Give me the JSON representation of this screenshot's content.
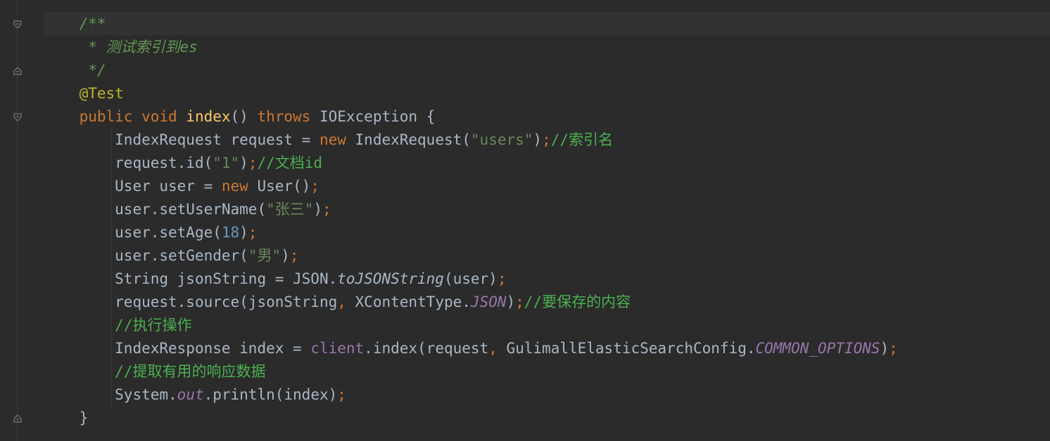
{
  "code_lines": [
    {
      "indent": "    ",
      "tokens": [
        {
          "t": "cmt",
          "v": "/**"
        }
      ]
    },
    {
      "indent": "     ",
      "tokens": [
        {
          "t": "cmt",
          "v": "* 测试索引到es"
        }
      ]
    },
    {
      "indent": "     ",
      "tokens": [
        {
          "t": "cmt",
          "v": "*/"
        }
      ]
    },
    {
      "indent": "    ",
      "tokens": [
        {
          "t": "ann",
          "v": "@Test"
        }
      ]
    },
    {
      "indent": "    ",
      "tokens": [
        {
          "t": "kw",
          "v": "public void "
        },
        {
          "t": "fn",
          "v": "index"
        },
        {
          "t": "plain",
          "v": "() "
        },
        {
          "t": "kw",
          "v": "throws "
        },
        {
          "t": "plain",
          "v": "IOException {"
        }
      ]
    },
    {
      "indent": "        ",
      "tokens": [
        {
          "t": "plain",
          "v": "IndexRequest request = "
        },
        {
          "t": "kw",
          "v": "new "
        },
        {
          "t": "plain",
          "v": "IndexRequest("
        },
        {
          "t": "str",
          "v": "\"users\""
        },
        {
          "t": "plain",
          "v": ")"
        },
        {
          "t": "kw",
          "v": ";"
        },
        {
          "t": "lcmt",
          "v": "//索引名"
        }
      ]
    },
    {
      "indent": "        ",
      "tokens": [
        {
          "t": "plain",
          "v": "request.id("
        },
        {
          "t": "str",
          "v": "\"1\""
        },
        {
          "t": "plain",
          "v": ")"
        },
        {
          "t": "kw",
          "v": ";"
        },
        {
          "t": "lcmt",
          "v": "//文档id"
        }
      ]
    },
    {
      "indent": "        ",
      "tokens": [
        {
          "t": "plain",
          "v": "User user = "
        },
        {
          "t": "kw",
          "v": "new "
        },
        {
          "t": "plain",
          "v": "User()"
        },
        {
          "t": "kw",
          "v": ";"
        }
      ]
    },
    {
      "indent": "        ",
      "tokens": [
        {
          "t": "plain",
          "v": "user.setUserName("
        },
        {
          "t": "str",
          "v": "\"张三\""
        },
        {
          "t": "plain",
          "v": ")"
        },
        {
          "t": "kw",
          "v": ";"
        }
      ]
    },
    {
      "indent": "        ",
      "tokens": [
        {
          "t": "plain",
          "v": "user.setAge("
        },
        {
          "t": "num",
          "v": "18"
        },
        {
          "t": "plain",
          "v": ")"
        },
        {
          "t": "kw",
          "v": ";"
        }
      ]
    },
    {
      "indent": "        ",
      "tokens": [
        {
          "t": "plain",
          "v": "user.setGender("
        },
        {
          "t": "str",
          "v": "\"男\""
        },
        {
          "t": "plain",
          "v": ")"
        },
        {
          "t": "kw",
          "v": ";"
        }
      ]
    },
    {
      "indent": "        ",
      "tokens": [
        {
          "t": "plain",
          "v": "String jsonString = JSON."
        },
        {
          "t": "ital",
          "v": "toJSONString"
        },
        {
          "t": "plain",
          "v": "(user)"
        },
        {
          "t": "kw",
          "v": ";"
        }
      ]
    },
    {
      "indent": "        ",
      "tokens": [
        {
          "t": "plain",
          "v": "request.source(jsonString"
        },
        {
          "t": "kw",
          "v": ", "
        },
        {
          "t": "plain",
          "v": "XContentType."
        },
        {
          "t": "fldi",
          "v": "JSON"
        },
        {
          "t": "plain",
          "v": ")"
        },
        {
          "t": "kw",
          "v": ";"
        },
        {
          "t": "lcmt",
          "v": "//要保存的内容"
        }
      ]
    },
    {
      "indent": "        ",
      "tokens": [
        {
          "t": "lcmt",
          "v": "//执行操作"
        }
      ]
    },
    {
      "indent": "        ",
      "tokens": [
        {
          "t": "plain",
          "v": "IndexResponse index = "
        },
        {
          "t": "fld",
          "v": "client"
        },
        {
          "t": "plain",
          "v": ".index(request"
        },
        {
          "t": "kw",
          "v": ", "
        },
        {
          "t": "plain",
          "v": "GulimallElasticSearchConfig."
        },
        {
          "t": "fldi",
          "v": "COMMON_OPTIONS"
        },
        {
          "t": "plain",
          "v": ")"
        },
        {
          "t": "kw",
          "v": ";"
        }
      ]
    },
    {
      "indent": "        ",
      "tokens": [
        {
          "t": "lcmt",
          "v": "//提取有用的响应数据"
        }
      ]
    },
    {
      "indent": "        ",
      "tokens": [
        {
          "t": "plain",
          "v": "System."
        },
        {
          "t": "fldi",
          "v": "out"
        },
        {
          "t": "plain",
          "v": ".println(index)"
        },
        {
          "t": "kw",
          "v": ";"
        }
      ]
    },
    {
      "indent": "    ",
      "tokens": [
        {
          "t": "plain",
          "v": "}"
        }
      ]
    }
  ],
  "fold_markers": [
    {
      "line": 0,
      "icon": "fold-open-icon"
    },
    {
      "line": 2,
      "icon": "fold-close-icon"
    },
    {
      "line": 4,
      "icon": "fold-open-icon"
    },
    {
      "line": 17,
      "icon": "fold-close-icon"
    }
  ],
  "colors": {
    "background": "#2b2b2b",
    "keyword": "#cc7832",
    "method": "#ffc66d",
    "string": "#6a8759",
    "number": "#6897bb",
    "doc_comment": "#629755",
    "line_comment": "#4caf50",
    "annotation": "#bbb529",
    "field": "#9876aa",
    "text": "#a9b7c6"
  }
}
